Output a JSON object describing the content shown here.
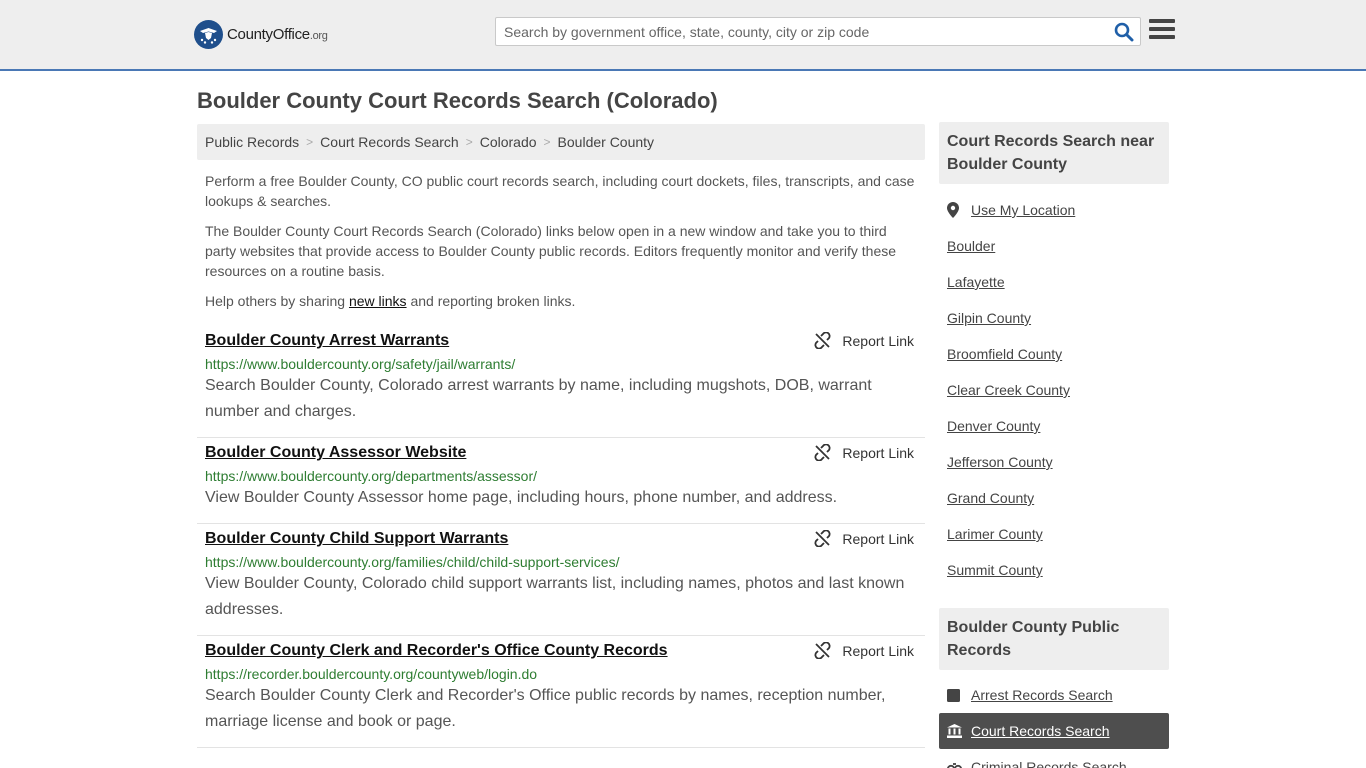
{
  "header": {
    "logo_name": "CountyOffice",
    "logo_suffix": ".org",
    "search_placeholder": "Search by government office, state, county, city or zip code",
    "search_icon": "search-icon",
    "menu_icon": "hamburger-menu-icon"
  },
  "page": {
    "title": "Boulder County Court Records Search (Colorado)"
  },
  "breadcrumb": [
    "Public Records",
    "Court Records Search",
    "Colorado",
    "Boulder County"
  ],
  "intro": {
    "p1": "Perform a free Boulder County, CO public court records search, including court dockets, files, transcripts, and case lookups & searches.",
    "p2": "The Boulder County Court Records Search (Colorado) links below open in a new window and take you to third party websites that provide access to Boulder County public records. Editors frequently monitor and verify these resources on a routine basis.",
    "p3_before": "Help others by sharing ",
    "p3_link": "new links",
    "p3_after": " and reporting broken links."
  },
  "report_label": "Report Link",
  "results": [
    {
      "title": "Boulder County Arrest Warrants",
      "url": "https://www.bouldercounty.org/safety/jail/warrants/",
      "desc": "Search Boulder County, Colorado arrest warrants by name, including mugshots, DOB, warrant number and charges."
    },
    {
      "title": "Boulder County Assessor Website",
      "url": "https://www.bouldercounty.org/departments/assessor/",
      "desc": "View Boulder County Assessor home page, including hours, phone number, and address."
    },
    {
      "title": "Boulder County Child Support Warrants",
      "url": "https://www.bouldercounty.org/families/child/child-support-services/",
      "desc": "View Boulder County, Colorado child support warrants list, including names, photos and last known addresses."
    },
    {
      "title": "Boulder County Clerk and Recorder's Office County Records",
      "url": "https://recorder.bouldercounty.org/countyweb/login.do",
      "desc": "Search Boulder County Clerk and Recorder's Office public records by names, reception number, marriage license and book or page."
    }
  ],
  "sidebar": {
    "near_heading": "Court Records Search near Boulder County",
    "use_location": "Use My Location",
    "near_items": [
      "Boulder",
      "Lafayette",
      "Gilpin County",
      "Broomfield County",
      "Clear Creek County",
      "Denver County",
      "Jefferson County",
      "Grand County",
      "Larimer County",
      "Summit County"
    ],
    "public_heading": "Boulder County Public Records",
    "public_items": [
      {
        "label": "Arrest Records Search",
        "icon": "square-icon"
      },
      {
        "label": "Court Records Search",
        "icon": "courthouse-icon"
      },
      {
        "label": "Criminal Records Search",
        "icon": "handcuffs-icon"
      }
    ]
  }
}
